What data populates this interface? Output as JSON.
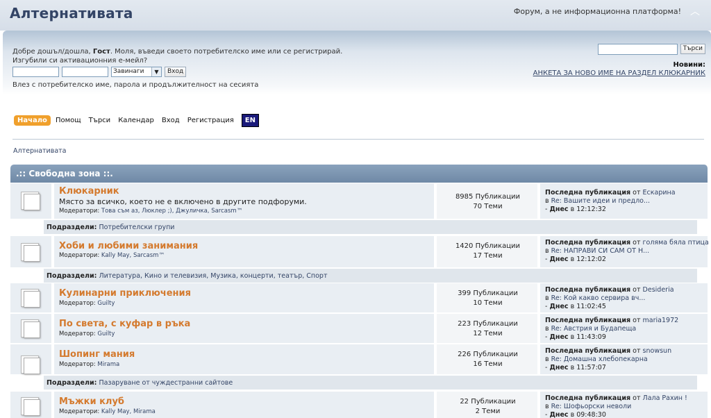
{
  "header": {
    "title": "Алтернативата",
    "slogan": "Форум, а не информационна платформа!"
  },
  "user": {
    "welcome_prefix": "Добре дошъл/дошла, ",
    "guest": "Гост",
    "welcome_suffix": ". Моля, въведи своето потребителско име или се регистрирай.",
    "activation": "Изгубили си активационния е-мейл?",
    "duration_option": "Завинаги",
    "login_button": "Вход",
    "hint": "Влез с потребителско име, парола и продължителност на сесията"
  },
  "search": {
    "button": "Търси"
  },
  "news": {
    "label": "Новини:",
    "link": "АНКЕТА ЗА НОВО ИМЕ НА РАЗДЕЛ КЛЮКАРНИК"
  },
  "menu": {
    "home": "Начало",
    "help": "Помощ",
    "search": "Търси",
    "calendar": "Календар",
    "login": "Вход",
    "register": "Регистрация",
    "lang": "EN"
  },
  "breadcrumb": "Алтернативата",
  "category": ".:: Свободна зона ::.",
  "labels": {
    "posts": "Публикации",
    "topics": "Теми",
    "moderators": "Модератори:",
    "moderator": "Модератор:",
    "subboards": "Подраздели:",
    "last_post": "Последна публикация",
    "by": "от",
    "in": "в",
    "today": "Днес"
  },
  "boards": [
    {
      "name": "Клюкарник",
      "desc": "Място за всичко, което не е включено в другите подфоруми.",
      "mods_label": "Модератори:",
      "mods": "Това съм аз, Люклер ;), Джуличка, Sarcasm™",
      "posts": "8985 Публикации",
      "topics": "70 Теми",
      "last_by": "Ескарина",
      "last_in": "Re: Вашите идеи и предло...",
      "last_time": "в 12:12:32",
      "sub": "Потребителски групи"
    },
    {
      "name": "Хоби и любими занимания",
      "desc": "",
      "mods_label": "Модератори:",
      "mods": "Kally May, Sarcasm™",
      "posts": "1420 Публикации",
      "topics": "17 Теми",
      "last_by": "голяма бяла птица",
      "last_in": "Re: НАПРАВИ СИ САМ ОТ Н...",
      "last_time": "в 12:12:02",
      "sub": "Литература, Кино и телевизия, Музика, концерти, театър, Спорт"
    },
    {
      "name": "Кулинарни приключения",
      "desc": "",
      "mods_label": "Модератор:",
      "mods": "Guilty",
      "posts": "399 Публикации",
      "topics": "10 Теми",
      "last_by": "Desideria",
      "last_in": "Re: Кой какво сервира вч...",
      "last_time": "в 11:02:45",
      "sub": ""
    },
    {
      "name": "По света, с куфар в ръка",
      "desc": "",
      "mods_label": "Модератор:",
      "mods": "Guilty",
      "posts": "223 Публикации",
      "topics": "12 Теми",
      "last_by": "maria1972",
      "last_in": "Re: Австрия и Будапеща",
      "last_time": "в 11:43:09",
      "sub": ""
    },
    {
      "name": "Шопинг мания",
      "desc": "",
      "mods_label": "Модератор:",
      "mods": "Mirama",
      "posts": "226 Публикации",
      "topics": "16 Теми",
      "last_by": "snowsun",
      "last_in": "Re: Домашна хлебопекарна",
      "last_time": "в 11:57:07",
      "sub": "Пазаруване от чуждестранни сайтове"
    },
    {
      "name": "Мъжки клуб",
      "desc": "",
      "mods_label": "Модератори:",
      "mods": "Kally May, Mirama",
      "posts": "22 Публикации",
      "topics": "2 Теми",
      "last_by": "Лала Рахин !",
      "last_in": "Re: Шофьорски неволи",
      "last_time": "в 09:48:30",
      "sub": ""
    }
  ]
}
